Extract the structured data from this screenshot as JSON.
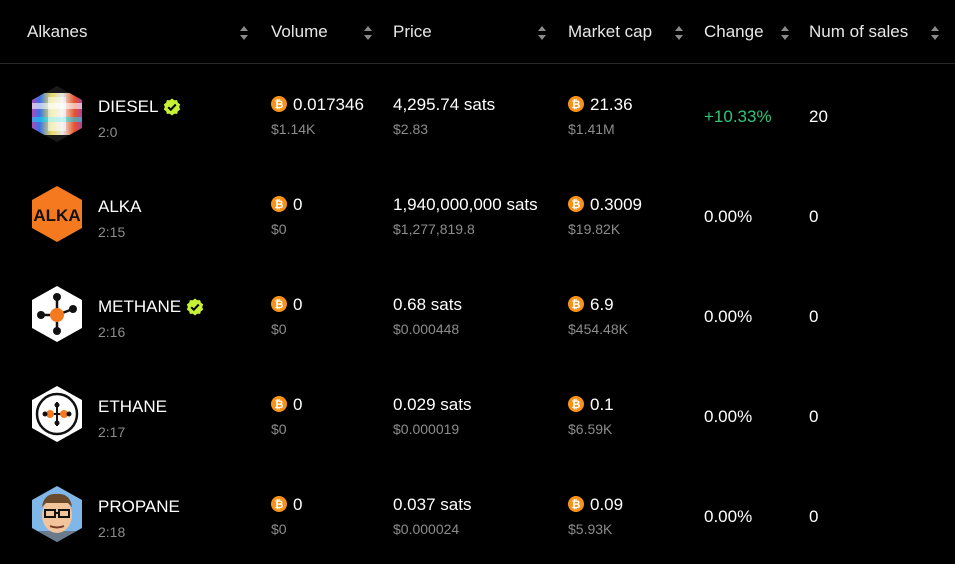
{
  "headers": {
    "alkanes": "Alkanes",
    "volume": "Volume",
    "price": "Price",
    "market_cap": "Market cap",
    "change": "Change",
    "num_sales": "Num of sales"
  },
  "colors": {
    "positive": "#2fc57a",
    "neutral": "#ffffff",
    "btc": "#f7931a",
    "verified": "#c6f135"
  },
  "rows": [
    {
      "name": "DIESEL",
      "id": "2:0",
      "verified": true,
      "logo": "diesel-logo",
      "volume_btc": "0.017346",
      "volume_usd": "$1.14K",
      "price_sats": "4,295.74 sats",
      "price_usd": "$2.83",
      "mcap_btc": "21.36",
      "mcap_usd": "$1.41M",
      "change": "+10.33%",
      "sales": "20"
    },
    {
      "name": "ALKA",
      "id": "2:15",
      "verified": false,
      "logo": "alka-logo",
      "logo_text": "ALKA",
      "volume_btc": "0",
      "volume_usd": "$0",
      "price_sats": "1,940,000,000 sats",
      "price_usd": "$1,277,819.8",
      "mcap_btc": "0.3009",
      "mcap_usd": "$19.82K",
      "change": "0.00%",
      "sales": "0"
    },
    {
      "name": "METHANE",
      "id": "2:16",
      "verified": true,
      "logo": "methane-logo",
      "volume_btc": "0",
      "volume_usd": "$0",
      "price_sats": "0.68 sats",
      "price_usd": "$0.000448",
      "mcap_btc": "6.9",
      "mcap_usd": "$454.48K",
      "change": "0.00%",
      "sales": "0"
    },
    {
      "name": "ETHANE",
      "id": "2:17",
      "verified": false,
      "logo": "ethane-logo",
      "volume_btc": "0",
      "volume_usd": "$0",
      "price_sats": "0.029 sats",
      "price_usd": "$0.000019",
      "mcap_btc": "0.1",
      "mcap_usd": "$6.59K",
      "change": "0.00%",
      "sales": "0"
    },
    {
      "name": "PROPANE",
      "id": "2:18",
      "verified": false,
      "logo": "propane-logo",
      "volume_btc": "0",
      "volume_usd": "$0",
      "price_sats": "0.037 sats",
      "price_usd": "$0.000024",
      "mcap_btc": "0.09",
      "mcap_usd": "$5.93K",
      "change": "0.00%",
      "sales": "0"
    }
  ]
}
